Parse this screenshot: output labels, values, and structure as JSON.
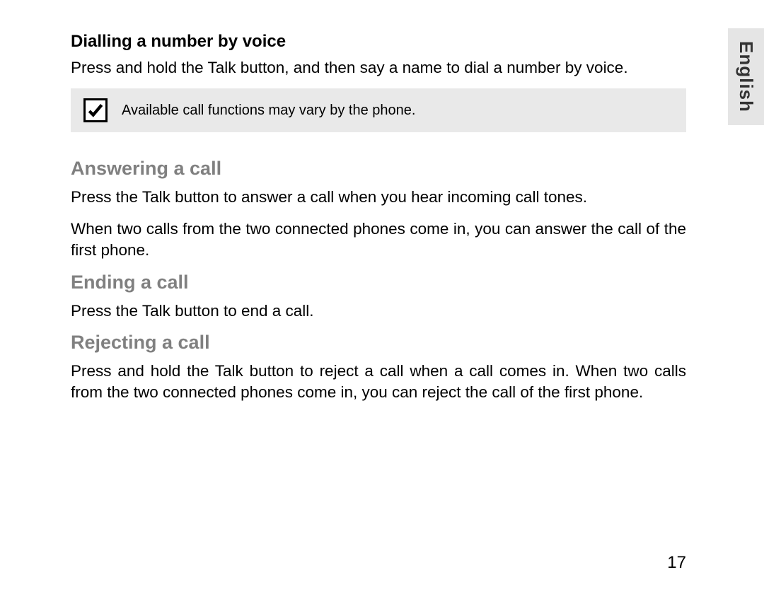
{
  "language_tab": "English",
  "section1": {
    "heading": "Dialling a number by voice",
    "text": "Press and hold the Talk button, and then say a name to dial a number by voice."
  },
  "note": {
    "text": "Available call functions may vary by the phone."
  },
  "section2": {
    "heading": "Answering a call",
    "text1": "Press the Talk button to answer a call when you hear incoming call tones.",
    "text2": "When two calls from the two connected phones come in, you can answer the call of the first phone."
  },
  "section3": {
    "heading": "Ending a call",
    "text": "Press the Talk button to end a call."
  },
  "section4": {
    "heading": "Rejecting a call",
    "text": "Press and hold the Talk button to reject a call when a call comes in. When two calls from the two connected phones come in, you can reject the call of the first phone."
  },
  "page_number": "17"
}
